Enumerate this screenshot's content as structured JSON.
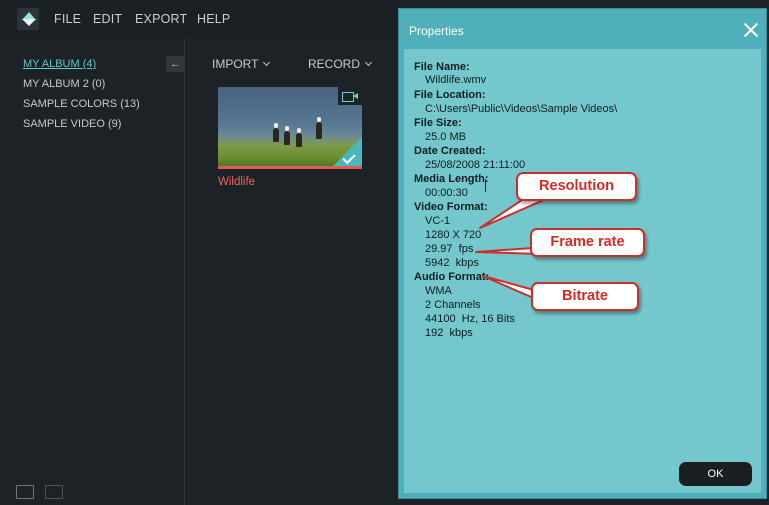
{
  "menubar": {
    "items": [
      "FILE",
      "EDIT",
      "EXPORT",
      "HELP"
    ]
  },
  "sidebar": {
    "albums": [
      "MY ALBUM (4)",
      "MY ALBUM 2 (0)",
      "SAMPLE COLORS (13)",
      "SAMPLE VIDEO (9)"
    ],
    "active_album": "MY ALBUM (4)",
    "collapse_icon": "arrow-left-icon"
  },
  "toolbar": {
    "import_label": "IMPORT",
    "record_label": "RECORD"
  },
  "media": {
    "clip_title": "Wildlife"
  },
  "dialog": {
    "title": "Properties",
    "ok_label": "OK",
    "file_name_label": "File Name:",
    "file_name": "Wildlife.wmv",
    "file_location_label": "File Location:",
    "file_location": "C:\\Users\\Public\\Videos\\Sample Videos\\",
    "file_size_label": "File Size:",
    "file_size": "25.0 MB",
    "date_created_label": "Date Created:",
    "date_created": "25/08/2008 21:11:00",
    "media_length_label": "Media Length:",
    "media_length": "00:00:30",
    "video_format_label": "Video Format:",
    "video_codec": "VC-1",
    "video_resolution": "1280 X 720",
    "video_fps": "29.97  fps",
    "video_bitrate": "5942  kbps",
    "audio_format_label": "Audio Format:",
    "audio_codec": "WMA",
    "audio_channels": "2 Channels",
    "audio_sample": "44100  Hz, 16 Bits",
    "audio_bitrate": "192  kbps"
  },
  "callouts": {
    "resolution": "Resolution",
    "frame_rate": "Frame rate",
    "bitrate": "Bitrate"
  },
  "colors": {
    "dialog_bg": "#74c8cd",
    "dialog_frame": "#4fb0bb",
    "callout_red": "#d52b25",
    "editor_bg": "#1d2226",
    "accent": "#5ec8ca"
  }
}
